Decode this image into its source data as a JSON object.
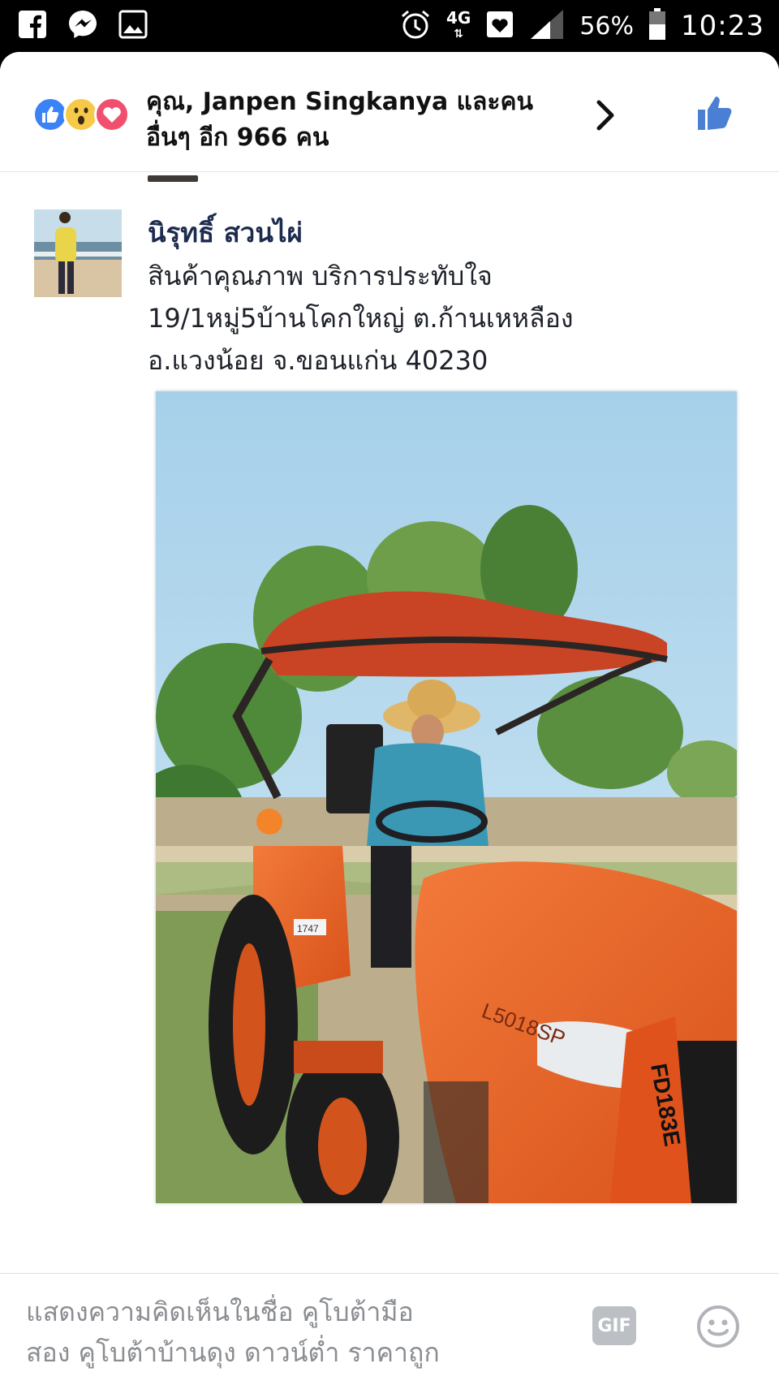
{
  "status_bar": {
    "network": "4G",
    "battery": "56%",
    "time": "10:23"
  },
  "reactions": {
    "summary_line1": "คุณ, Janpen Singkanya และคน",
    "summary_line2": "อื่นๆ อีก 966 คน"
  },
  "comment": {
    "author": "นิรุทธิ์ สวนไผ่",
    "lines": [
      "สินค้าคุณภาพ  บริการประทับใจ",
      "19/1หมู่5บ้านโคกใหญ่ ต.ก้านเหหลือง",
      "อ.แวงน้อย จ.ขอนแก่น  40230"
    ],
    "photo_text": {
      "model": "L5018SP",
      "plate": "FD183E",
      "badge": "1747"
    }
  },
  "composer": {
    "placeholder_line1": "แสดงความคิดเห็นในชื่อ คูโบต้ามือ",
    "placeholder_line2": "สอง คูโบต้าบ้านดุง ดาวน์ต่ำ ราคาถูก",
    "gif_label": "GIF"
  },
  "colors": {
    "like_blue": "#3b82f6",
    "love_red": "#f0506e",
    "wow_yellow": "#f7c948",
    "name_color": "#1d2b4f"
  }
}
